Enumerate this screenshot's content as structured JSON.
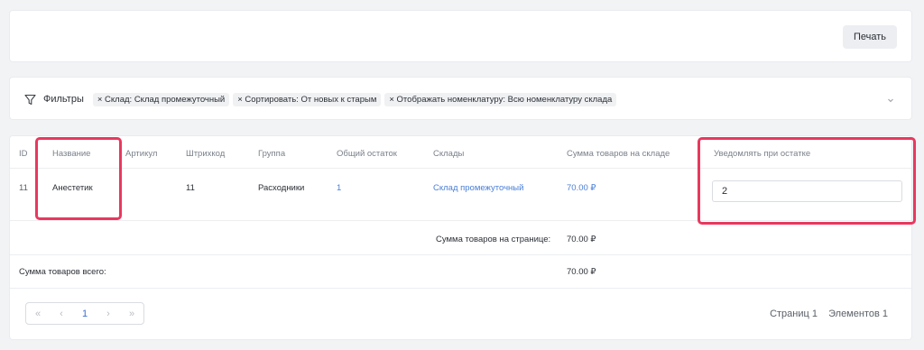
{
  "toolbar": {
    "print_label": "Печать"
  },
  "filters": {
    "label": "Фильтры",
    "chips": [
      "× Склад: Склад промежуточный",
      "× Сортировать: От новых к старым",
      "× Отображать номенклатуру: Всю номенклатуру склада"
    ]
  },
  "table": {
    "columns": {
      "id": "ID",
      "name": "Название",
      "article": "Артикул",
      "barcode": "Штрихкод",
      "group": "Группа",
      "total_stock": "Общий остаток",
      "warehouses": "Склады",
      "warehouse_sum": "Сумма товаров на складе",
      "notify": "Уведомлять при остатке"
    },
    "rows": [
      {
        "id": "11",
        "name": "Анестетик",
        "article": "",
        "barcode": "11",
        "group": "Расходники",
        "total_stock": "1",
        "warehouse": "Склад промежуточный",
        "sum": "70.00 ₽",
        "notify_value": "2"
      }
    ],
    "page_sum_label": "Сумма товаров на странице:",
    "page_sum_value": "70.00 ₽",
    "total_sum_label": "Сумма товаров всего:",
    "total_sum_value": "70.00 ₽"
  },
  "pagination": {
    "first": "«",
    "prev": "‹",
    "current": "1",
    "next": "›",
    "last": "»",
    "pages_info": "Страниц 1",
    "elements_info": "Элементов 1"
  },
  "colors": {
    "highlight": "#e8385e",
    "link": "#4a7fd6"
  }
}
